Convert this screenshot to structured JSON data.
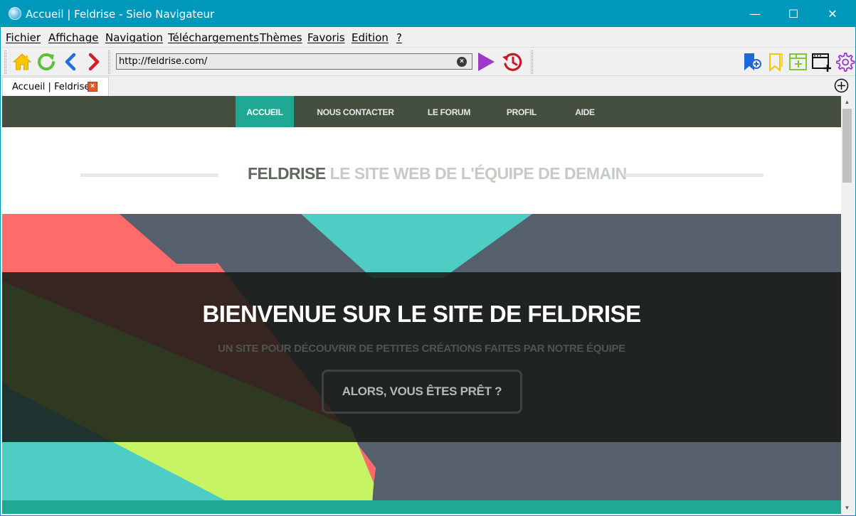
{
  "window": {
    "title": "Accueil | Feldrise - Sielo Navigateur",
    "minimize": "—",
    "maximize": "☐",
    "close": "✕"
  },
  "menu": [
    "Fichier",
    "Affichage",
    "Navigation",
    "Téléchargements",
    "Thèmes",
    "Favoris",
    "Edition",
    "?"
  ],
  "toolbar": {
    "url": "http://feldrise.com/",
    "clear": "×",
    "icons": [
      "home-icon",
      "reload-icon",
      "back-icon",
      "forward-icon",
      "go-icon",
      "history-icon",
      "add-bookmark-icon",
      "bookmarks-icon",
      "new-tab-panel-icon",
      "new-window-icon",
      "settings-icon"
    ]
  },
  "tabs": [
    {
      "label": "Accueil | Feldrise",
      "close": "×"
    }
  ],
  "site": {
    "nav": [
      "ACCUEIL",
      "NOUS CONTACTER",
      "LE FORUM",
      "PROFIL",
      "AIDE"
    ],
    "name": "FELDRISE",
    "tagline": " LE SITE WEB DE L'ÉQUIPE DE DEMAIN",
    "hero_title": "BIENVENUE SUR LE SITE DE FELDRISE",
    "hero_subtitle": "UN SITE POUR DÉCOUVRIR DE PETITES CRÉATIONS FAITES PAR NOTRE ÉQUIPE",
    "hero_button": "ALORS, VOUS ÊTES PRÊT ?"
  },
  "colors": {
    "titlebar": "#0099bc",
    "nav_bg": "#454f3f",
    "nav_active": "#1fa893",
    "hero_coral": "#fd6b6b",
    "hero_teal": "#4ecdc4",
    "hero_lime": "#c7f464",
    "hero_slate": "#55606c"
  }
}
